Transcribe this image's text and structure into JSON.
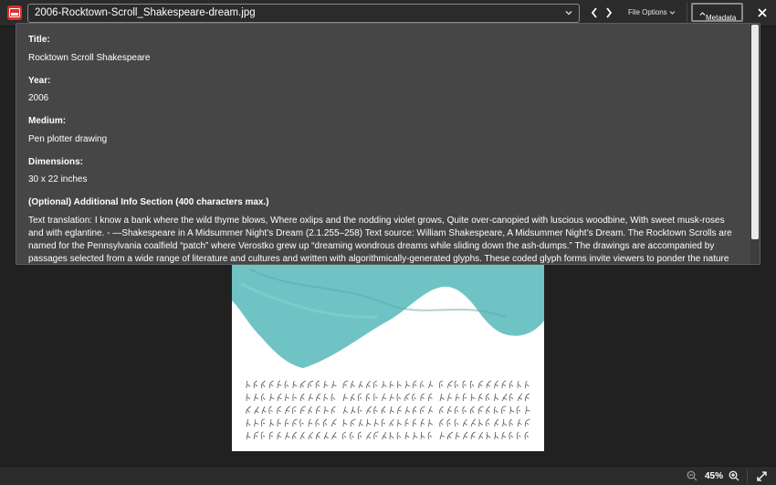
{
  "topbar": {
    "file_name": "2006-Rocktown-Scroll_Shakespeare-dream.jpg",
    "file_options_label": "File Options",
    "metadata_label": "Metadata"
  },
  "metadata": {
    "fields": [
      {
        "label": "Title:",
        "value": "Rocktown Scroll Shakespeare"
      },
      {
        "label": "Year:",
        "value": "2006"
      },
      {
        "label": "Medium:",
        "value": "Pen plotter drawing"
      },
      {
        "label": "Dimensions:",
        "value": "30 x 22 inches"
      }
    ],
    "additional": {
      "label": "(Optional) Additional Info Section (400 characters max.)",
      "text": "Text translation: I know a bank where the wild thyme blows, Where oxlips and the nodding violet grows, Quite over-canopied with luscious woodbine, With sweet musk-roses and with eglantine. - —Shakespeare in A Midsummer Night’s Dream (2.1.255–258) Text source: William Shakespeare, A Midsummer Night’s Dream. The Rocktown Scrolls are named for the Pennsylvania coalfield “patch” where Verostko grew up “dreaming wondrous dreams while sliding down the ash-dumps.” The drawings are accompanied by passages selected from a wide range of literature and cultures and written with algorithmically-generated glyphs. These coded glyph forms invite viewers to ponder the nature of language"
    }
  },
  "bottombar": {
    "zoom_level": "45%"
  },
  "colors": {
    "accent_red": "#d9302c",
    "panel_bg": "#464646",
    "artwork_teal": "#6fc3c4"
  },
  "icons": {
    "app": "image-file-icon",
    "dropdown": "chevron-down-icon",
    "prev": "chevron-left-icon",
    "next": "chevron-right-icon",
    "close": "close-icon",
    "zoom_out": "zoom-out-icon",
    "zoom_in": "zoom-in-icon",
    "expand": "expand-icon"
  }
}
